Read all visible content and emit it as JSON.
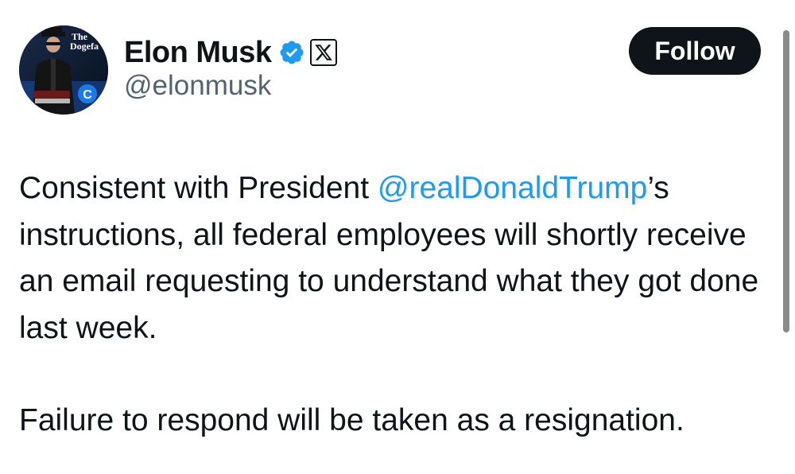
{
  "author": {
    "display_name": "Elon Musk",
    "handle": "@elonmusk",
    "avatar_hat_text": [
      "The",
      "Dogefa"
    ],
    "avatar_badge_letter": "C"
  },
  "badges": {
    "verified_icon": "verified-checkmark-icon",
    "verified_color": "#1d9bf0",
    "affiliate_icon": "x-logo-icon"
  },
  "actions": {
    "follow_label": "Follow"
  },
  "tweet": {
    "text_before_mention": "Consistent with President ",
    "mention": "@realDonaldTrump",
    "text_after_mention": "’s instructions, all federal employees will shortly receive an email requesting to understand what they got done last week.",
    "second_paragraph": "Failure to respond will be taken as a resignation."
  },
  "colors": {
    "text": "#0f1419",
    "secondary_text": "#536471",
    "link": "#1d9bf0",
    "button_bg": "#0f1419",
    "button_text": "#ffffff"
  }
}
